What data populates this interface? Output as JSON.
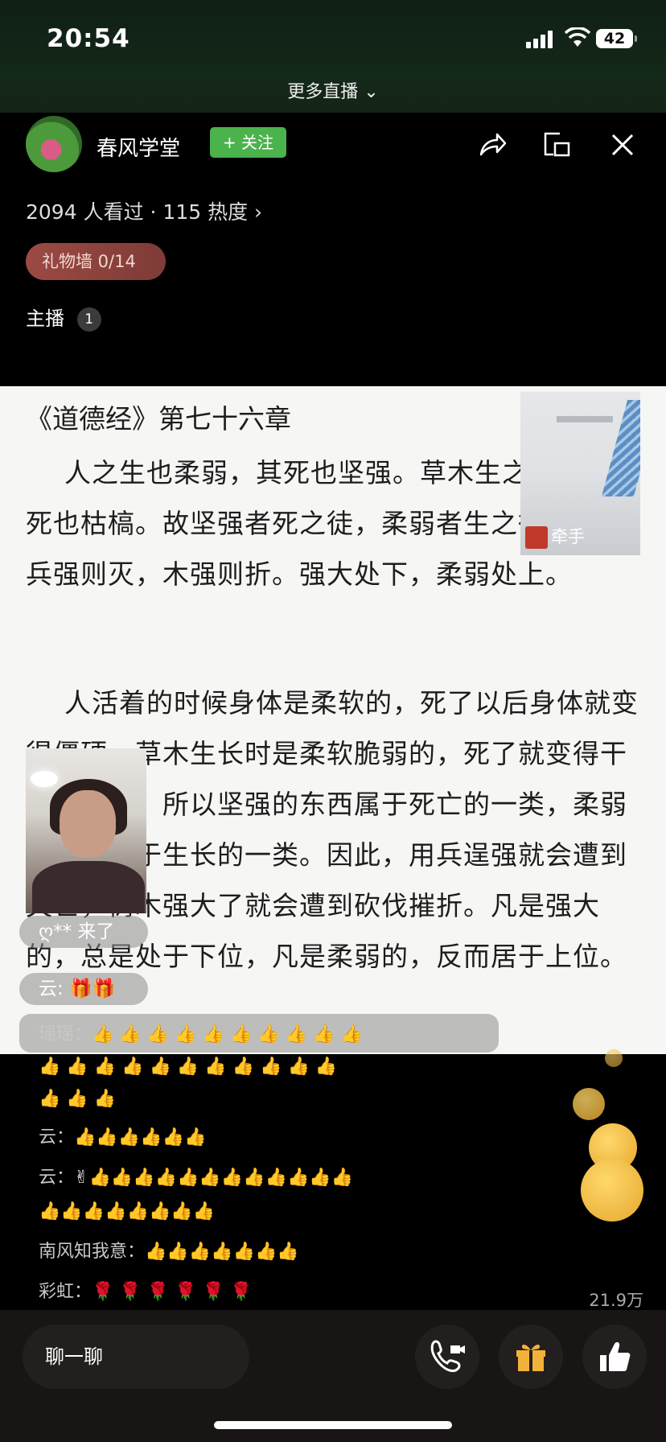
{
  "status": {
    "time": "20:54",
    "battery": "42"
  },
  "more_live": "更多直播",
  "host": {
    "name": "春风学堂",
    "follow_label": "+ 关注"
  },
  "stats": "2094 人看过 · 115 热度",
  "gift_wall": "礼物墙 0/14",
  "anchor": {
    "label": "主播",
    "count": "1"
  },
  "document": {
    "title": "《道德经》第七十六章",
    "paragraphs": [
      "人之生也柔弱，其死也坚强。草木生之柔脆，其死也枯槁。故坚强者死之徒，柔弱者生之徒。是以兵强则灭，木强则折。强大处下，柔弱处上。",
      "人活着的时候身体是柔软的，死了以后身体就变得僵硬。草木生长时是柔软脆弱的，死了就变得干硬枯槁了。所以坚强的东西属于死亡的一类，柔弱的东西属于生长的一类。因此，用兵逞强就会遭到灭亡，树木强大了就会遭到砍伐摧折。凡是强大的，总是处于下位，凡是柔弱的，反而居于上位。"
    ]
  },
  "pip_tag": "牵手",
  "overlays": {
    "join_notice": "ღ** 来了",
    "gift_notice": "云: 🎁🎁"
  },
  "chat": [
    {
      "name": "瑶瑶：",
      "text": "👍 👍 👍 👍 👍 👍 👍 👍 👍 👍"
    },
    {
      "name": "",
      "text": "👍 👍 👍 👍 👍 👍 👍 👍 👍 👍 👍"
    },
    {
      "name": "",
      "text": "👍 👍 👍"
    },
    {
      "name": "云：",
      "text": "👍👍👍👍👍👍"
    },
    {
      "name": "云：",
      "text": "✌👍👍👍👍👍👍👍👍👍👍👍👍"
    },
    {
      "name": "",
      "text": "👍👍👍👍👍👍👍👍"
    },
    {
      "name": "南风知我意：",
      "text": "👍👍👍👍👍👍👍"
    },
    {
      "name": "彩虹：",
      "text": "🌹 🌹 🌹 🌹 🌹 🌹"
    }
  ],
  "likes_count": "21.9万",
  "bottom": {
    "chat_placeholder": "聊一聊"
  },
  "colors": {
    "follow": "#4bb34b",
    "gift_wall": "#9c4a43",
    "doc_bg": "#f6f6f4"
  },
  "icons": [
    "share-icon",
    "pip-icon",
    "close-icon",
    "call-icon",
    "gift-icon",
    "like-icon"
  ]
}
